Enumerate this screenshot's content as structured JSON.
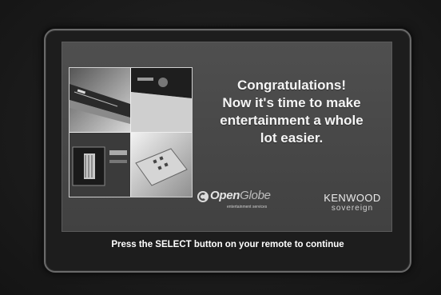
{
  "screen": {
    "headline_lines": [
      "Congratulations!",
      "Now it's time to make",
      "entertainment a whole",
      "lot easier."
    ],
    "openglobe_logo": {
      "brand_bold": "Open",
      "brand_light": "Globe",
      "tagline": "entertainment services",
      "icon": "openglobe-icon"
    },
    "kenwood_logo": {
      "brand": "KENWOOD",
      "sub": "sovereign"
    },
    "collage_images": [
      "equipment-photo-1",
      "equipment-photo-2",
      "equipment-photo-3",
      "equipment-photo-4"
    ]
  },
  "footer": {
    "instruction": "Press the SELECT button on your remote to continue"
  },
  "colors": {
    "screen_bg": "#484848",
    "text": "#f5f5f5",
    "frame_border": "#6a6a6a"
  }
}
